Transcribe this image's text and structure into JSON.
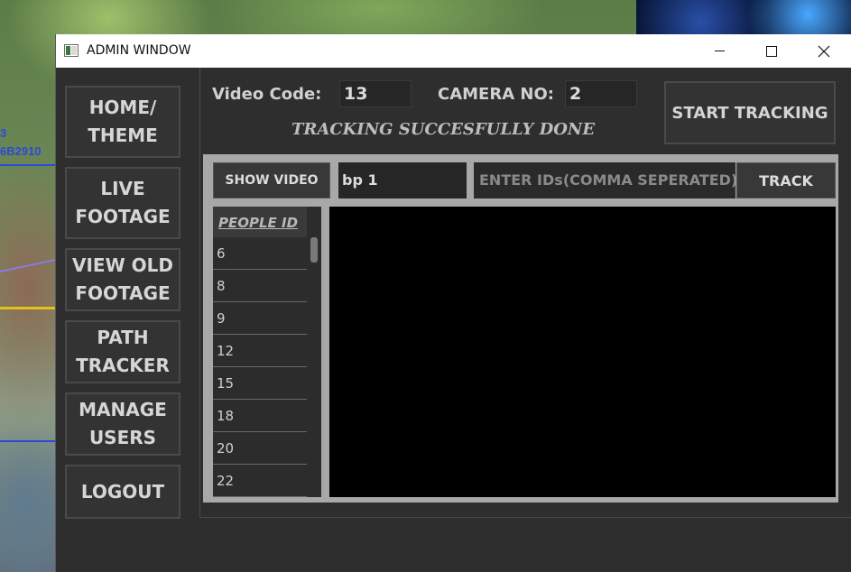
{
  "background": {
    "overlay_text_1": "3",
    "overlay_text_2": "6B2910"
  },
  "window": {
    "title": "ADMIN WINDOW",
    "controls": {
      "minimize": "minimize",
      "maximize": "maximize",
      "close": "✕"
    }
  },
  "nav": {
    "items": [
      {
        "label": "HOME/\nTHEME"
      },
      {
        "label": "LIVE\nFOOTAGE"
      },
      {
        "label": "VIEW OLD\nFOOTAGE"
      },
      {
        "label": "PATH\nTRACKER"
      },
      {
        "label": "MANAGE\nUSERS"
      },
      {
        "label": "LOGOUT"
      }
    ]
  },
  "header": {
    "video_code_label": "Video Code:",
    "video_code_value": "13",
    "camera_no_label": "CAMERA NO:",
    "camera_no_value": "2",
    "status_text": "TRACKING SUCCESFULLY DONE",
    "start_tracking_label": "START TRACKING"
  },
  "toolbar": {
    "show_video_label": "SHOW VIDEO",
    "video_name_value": "bp 1",
    "ids_placeholder": "ENTER IDs(COMMA SEPERATED)",
    "track_label": "TRACK"
  },
  "people": {
    "header": "PEOPLE ID",
    "ids": [
      "6",
      "8",
      "9",
      "12",
      "15",
      "18",
      "20",
      "22"
    ]
  },
  "colors": {
    "window_bg": "#2e2e2e",
    "button_bg": "#333333",
    "work_area_bg": "#a8a8a8",
    "video_bg": "#000000"
  }
}
